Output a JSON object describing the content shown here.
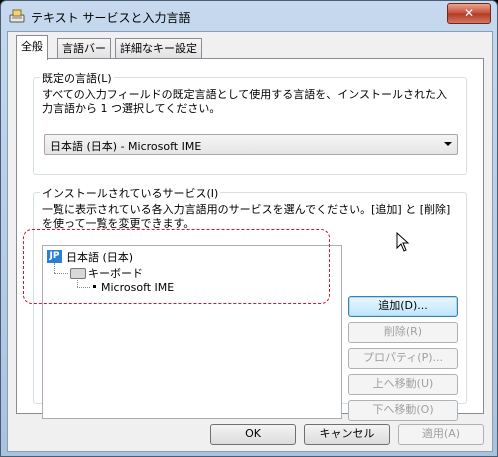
{
  "window": {
    "title": "テキスト サービスと入力言語",
    "close_glyph": "✕"
  },
  "tabs": [
    {
      "label": "全般",
      "active": true
    },
    {
      "label": "言語バー",
      "active": false
    },
    {
      "label": "詳細なキー設定",
      "active": false
    }
  ],
  "default_language": {
    "group_label": "既定の言語(L)",
    "description": "すべての入力フィールドの既定言語として使用する言語を、インストールされた入力言語から 1 つ選択してください。",
    "selected": "日本語 (日本) - Microsoft IME"
  },
  "installed_services": {
    "group_label": "インストールされているサービス(I)",
    "description": "一覧に表示されている各入力言語用のサービスを選んでください。[追加] と [削除] を使って一覧を変更できます。",
    "tree": {
      "badge": "JP",
      "language": "日本語 (日本)",
      "category": "キーボード",
      "service": "Microsoft IME"
    },
    "buttons": {
      "add": "追加(D)...",
      "remove": "削除(R)",
      "properties": "プロパティ(P)...",
      "move_up": "上へ移動(U)",
      "move_down": "下へ移動(O)"
    }
  },
  "footer": {
    "ok": "OK",
    "cancel": "キャンセル",
    "apply": "適用(A)"
  },
  "colors": {
    "highlight": "#e0102a",
    "close_button": "#c84b35",
    "jp_badge": "#2b7fd8"
  }
}
